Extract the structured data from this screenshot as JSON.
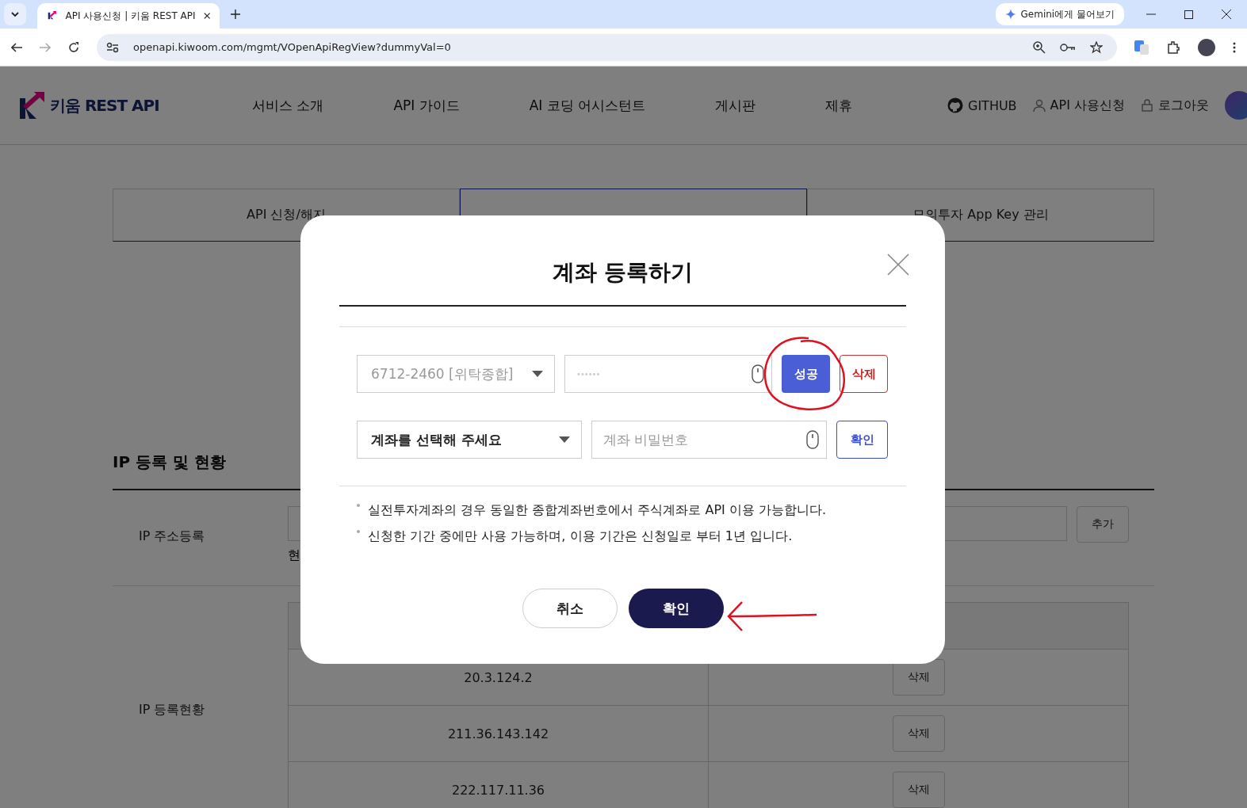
{
  "browser": {
    "tab_title": "API 사용신청 | 키움 REST API",
    "url": "openapi.kiwoom.com/mgmt/VOpenApiRegView?dummyVal=0",
    "gemini_button": "Gemini에게 물어보기"
  },
  "header": {
    "logo": "키움 REST API",
    "nav": [
      "서비스 소개",
      "API 가이드",
      "AI 코딩 어시스턴트",
      "게시판",
      "제휴"
    ],
    "user_links": [
      {
        "kind": "github",
        "label": "GITHUB"
      },
      {
        "kind": "user",
        "label": "API 사용신청"
      },
      {
        "kind": "lock",
        "label": "로그아웃"
      }
    ]
  },
  "tabs": [
    {
      "label": "API 신청/해지",
      "selected": false
    },
    {
      "selected": true
    },
    {
      "label": "모의투자 App Key 관리",
      "selected": false
    }
  ],
  "ip_section": {
    "title": "IP 등록 및 현황",
    "register_label": "IP 주소등록",
    "add_button": "추가",
    "note": "현",
    "status_label": "IP 등록현황",
    "rows": [
      {
        "ip": "20.3.124.2",
        "action": "삭제"
      },
      {
        "ip": "211.36.143.142",
        "action": "삭제"
      },
      {
        "ip": "222.117.11.36",
        "action": "삭제"
      }
    ]
  },
  "modal": {
    "title": "계좌 등록하기",
    "accounts": [
      {
        "kind": "registered",
        "account": "6712-2460 [위탁종합]",
        "password": "••••••",
        "status_button": "성공",
        "delete_button": "삭제"
      },
      {
        "kind": "new",
        "account": "계좌를 선택해 주세요",
        "password_placeholder": "계좌 비밀번호",
        "confirm_button": "확인"
      }
    ],
    "notes": [
      "실전투자계좌의 경우 동일한 종합계좌번호에서 주식계좌로 API 이용 가능합니다.",
      "신청한 기간 중에만 사용 가능하며, 이용 기간은 신청일로 부터 1년 입니다."
    ],
    "cancel_button": "취소",
    "confirm_button": "확인"
  }
}
